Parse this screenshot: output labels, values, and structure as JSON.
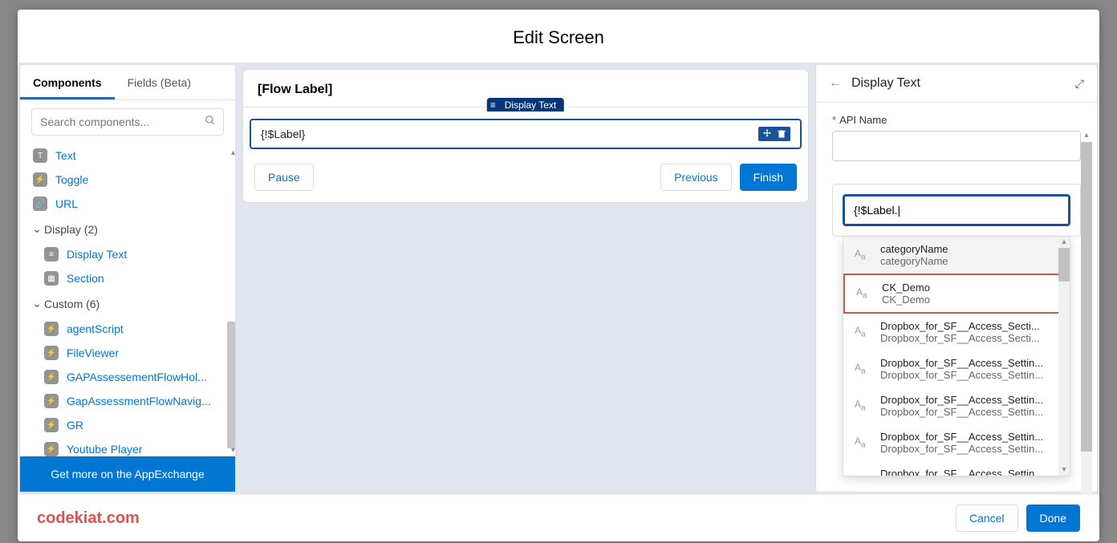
{
  "modal": {
    "title": "Edit Screen"
  },
  "left": {
    "tabs": [
      {
        "label": "Components"
      },
      {
        "label": "Fields (Beta)"
      }
    ],
    "search_placeholder": "Search components...",
    "input_items": [
      {
        "label": "Text"
      },
      {
        "label": "Toggle"
      },
      {
        "label": "URL"
      }
    ],
    "display_header": "Display (2)",
    "display_items": [
      {
        "label": "Display Text"
      },
      {
        "label": "Section"
      }
    ],
    "custom_header": "Custom (6)",
    "custom_items": [
      {
        "label": "agentScript"
      },
      {
        "label": "FileViewer"
      },
      {
        "label": "GAPAssessementFlowHol..."
      },
      {
        "label": "GapAssessmentFlowNavig..."
      },
      {
        "label": "GR"
      },
      {
        "label": "Youtube Player"
      }
    ],
    "exchange": "Get more on the AppExchange"
  },
  "center": {
    "flow_label": "[Flow Label]",
    "pill": "Display Text",
    "component_text": "{!$Label}",
    "pause": "Pause",
    "previous": "Previous",
    "finish": "Finish"
  },
  "right": {
    "title": "Display Text",
    "api_label": "API Name",
    "resource_value": "{!$Label.|",
    "dropdown": [
      {
        "t1": "categoryName",
        "t2": "categoryName"
      },
      {
        "t1": "CK_Demo",
        "t2": "CK_Demo"
      },
      {
        "t1": "Dropbox_for_SF__Access_Secti...",
        "t2": "Dropbox_for_SF__Access_Secti..."
      },
      {
        "t1": "Dropbox_for_SF__Access_Settin...",
        "t2": "Dropbox_for_SF__Access_Settin..."
      },
      {
        "t1": "Dropbox_for_SF__Access_Settin...",
        "t2": "Dropbox_for_SF__Access_Settin..."
      },
      {
        "t1": "Dropbox_for_SF__Access_Settin...",
        "t2": "Dropbox_for_SF__Access_Settin..."
      },
      {
        "t1": "Dropbox_for_SF__Access_Settin",
        "t2": ""
      }
    ]
  },
  "footer": {
    "brand": "codekiat.com",
    "cancel": "Cancel",
    "done": "Done"
  }
}
